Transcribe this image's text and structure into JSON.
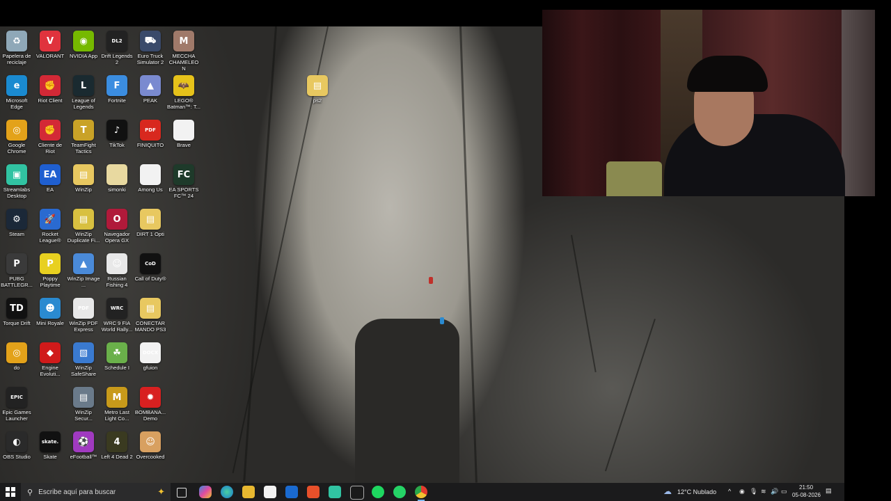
{
  "desktop_icons": [
    {
      "label": "Papelera de reciclaje",
      "icon": "recycle-bin-icon",
      "color": "#8fa8b8",
      "glyph": "♻"
    },
    {
      "label": "VALORANT",
      "icon": "valorant-icon",
      "color": "#e0333d",
      "glyph": "V"
    },
    {
      "label": "NVIDIA App",
      "icon": "nvidia-icon",
      "color": "#76b900",
      "glyph": "◉"
    },
    {
      "label": "Drift Legends 2",
      "icon": "drift-legends-icon",
      "color": "#222222",
      "glyph": "DL2"
    },
    {
      "label": "Euro Truck Simulator 2",
      "icon": "euro-truck-icon",
      "color": "#3a4a6a",
      "glyph": "⛟"
    },
    {
      "label": "MECCHA CHAMELEON",
      "icon": "meccha-chameleon-icon",
      "color": "#a07a6a",
      "glyph": "M"
    },
    {
      "label": "Microsoft Edge",
      "icon": "edge-icon",
      "color": "#1a8ad0",
      "glyph": "e"
    },
    {
      "label": "Riot Client",
      "icon": "riot-client-icon",
      "color": "#d32936",
      "glyph": "✊"
    },
    {
      "label": "League of Legends",
      "icon": "league-icon",
      "color": "#1a2a30",
      "glyph": "L"
    },
    {
      "label": "Fortnite",
      "icon": "fortnite-icon",
      "color": "#3b8de0",
      "glyph": "F"
    },
    {
      "label": "PEAK",
      "icon": "peak-icon",
      "color": "#7a8ad0",
      "glyph": "▲"
    },
    {
      "label": "LEGO® Batman™: T...",
      "icon": "lego-batman-icon",
      "color": "#e6c21a",
      "glyph": "🦇"
    },
    {
      "label": "Google Chrome",
      "icon": "chrome-icon",
      "color": "#e3a21a",
      "glyph": "◎"
    },
    {
      "label": "Cliente de Riot",
      "icon": "riot-client-icon",
      "color": "#d32936",
      "glyph": "✊"
    },
    {
      "label": "TeamFight Tactics",
      "icon": "tft-icon",
      "color": "#c9a227",
      "glyph": "T"
    },
    {
      "label": "TikTok",
      "icon": "tiktok-icon",
      "color": "#111111",
      "glyph": "♪"
    },
    {
      "label": "FINIQUITO",
      "icon": "pdf-file-icon",
      "color": "#d8281e",
      "glyph": "PDF"
    },
    {
      "label": "Brave",
      "icon": "file-icon",
      "color": "#f2f2f2",
      "glyph": ""
    },
    {
      "label": "Streamlabs Desktop",
      "icon": "streamlabs-icon",
      "color": "#31c3a2",
      "glyph": "▣"
    },
    {
      "label": "EA",
      "icon": "ea-icon",
      "color": "#1f5fd0",
      "glyph": "EA"
    },
    {
      "label": "WinZip",
      "icon": "winzip-folder-icon",
      "color": "#e8c860",
      "glyph": "▤"
    },
    {
      "label": "simonki",
      "icon": "file-icon",
      "color": "#e8d9a0",
      "glyph": ""
    },
    {
      "label": "Among Us",
      "icon": "file-icon",
      "color": "#f2f2f2",
      "glyph": ""
    },
    {
      "label": "EA SPORTS FC™ 24",
      "icon": "ea-fc-icon",
      "color": "#1e3a2a",
      "glyph": "FC"
    },
    {
      "label": "Steam",
      "icon": "steam-icon",
      "color": "#1b2838",
      "glyph": "⚙"
    },
    {
      "label": "Rocket League®",
      "icon": "rocket-league-icon",
      "color": "#2a6ad0",
      "glyph": "🚀"
    },
    {
      "label": "WinZip Duplicate Fi...",
      "icon": "winzip-icon",
      "color": "#d8c040",
      "glyph": "▤"
    },
    {
      "label": "Navegador Opera GX",
      "icon": "opera-gx-icon",
      "color": "#b01a3a",
      "glyph": "O"
    },
    {
      "label": "DIRT 1 Opti",
      "icon": "winzip-folder-icon",
      "color": "#e8c860",
      "glyph": "▤"
    },
    {
      "label": "PUBG BATTLEGR...",
      "icon": "pubg-icon",
      "color": "#3a3a3a",
      "glyph": "P"
    },
    {
      "label": "Poppy Playtime",
      "icon": "poppy-playtime-icon",
      "color": "#e8d020",
      "glyph": "P"
    },
    {
      "label": "WinZip Image ...",
      "icon": "winzip-image-icon",
      "color": "#4a8ad8",
      "glyph": "▲"
    },
    {
      "label": "Russian Fishing 4",
      "icon": "russian-fishing-icon",
      "color": "#e8e8e8",
      "glyph": "☺"
    },
    {
      "label": "Call of Duty®",
      "icon": "call-of-duty-icon",
      "color": "#111111",
      "glyph": "CoD"
    },
    {
      "label": "Torque Drift",
      "icon": "torque-drift-icon",
      "color": "#111111",
      "glyph": "TD"
    },
    {
      "label": "Mini Royale",
      "icon": "mini-royale-icon",
      "color": "#2a8ad0",
      "glyph": "☻"
    },
    {
      "label": "WinZip PDF Express",
      "icon": "winzip-pdf-icon",
      "color": "#e8e8e8",
      "glyph": "PDF"
    },
    {
      "label": "WRC 9 FIA World Rally...",
      "icon": "wrc9-icon",
      "color": "#222222",
      "glyph": "WRC"
    },
    {
      "label": "CONECTAR MANDO PS3",
      "icon": "winzip-folder-icon",
      "color": "#e8c860",
      "glyph": "▤"
    },
    {
      "label": "do",
      "icon": "chrome-icon",
      "color": "#e3a21a",
      "glyph": "◎"
    },
    {
      "label": "Engine Evoluti...",
      "icon": "engine-evolution-icon",
      "color": "#d01a1a",
      "glyph": "◆"
    },
    {
      "label": "WinZip SafeShare",
      "icon": "winzip-safeshare-icon",
      "color": "#3a7ad0",
      "glyph": "▧"
    },
    {
      "label": "Schedule I",
      "icon": "schedule-one-icon",
      "color": "#6ab04a",
      "glyph": "☘"
    },
    {
      "label": "gfuion",
      "icon": "docx-file-icon",
      "color": "#f2f2f2",
      "glyph": "DOCX"
    },
    {
      "label": "Epic Games Launcher",
      "icon": "epic-games-icon",
      "color": "#222222",
      "glyph": "EPIC"
    },
    {
      "label": "WinZip Secur...",
      "icon": "winzip-secure-icon",
      "color": "#6a7a8a",
      "glyph": "▤"
    },
    {
      "label": "Metro Last Light Co...",
      "icon": "metro-icon",
      "color": "#c89a1a",
      "glyph": "M"
    },
    {
      "label": "BOMBANA... Demo",
      "icon": "bombana-icon",
      "color": "#d82020",
      "glyph": "✹"
    },
    {
      "label": "OBS Studio",
      "icon": "obs-icon",
      "color": "#2a2a2a",
      "glyph": "◐"
    },
    {
      "label": "Skate",
      "icon": "skate-icon",
      "color": "#111111",
      "glyph": "skate."
    },
    {
      "label": "eFootball™",
      "icon": "efootball-icon",
      "color": "#a03ac0",
      "glyph": "⚽"
    },
    {
      "label": "Left 4 Dead 2",
      "icon": "left4dead-icon",
      "color": "#3a3a20",
      "glyph": "4"
    },
    {
      "label": "Overcooked",
      "icon": "overcooked-icon",
      "color": "#d8a060",
      "glyph": "☺"
    },
    {
      "label": "ps2",
      "icon": "winzip-folder-icon",
      "color": "#e8c860",
      "glyph": "▤"
    }
  ],
  "taskbar": {
    "search_placeholder": "Escribe aquí para buscar",
    "weather": "12°C  Nublado",
    "time": "21:50",
    "date": "05-08-2026"
  }
}
